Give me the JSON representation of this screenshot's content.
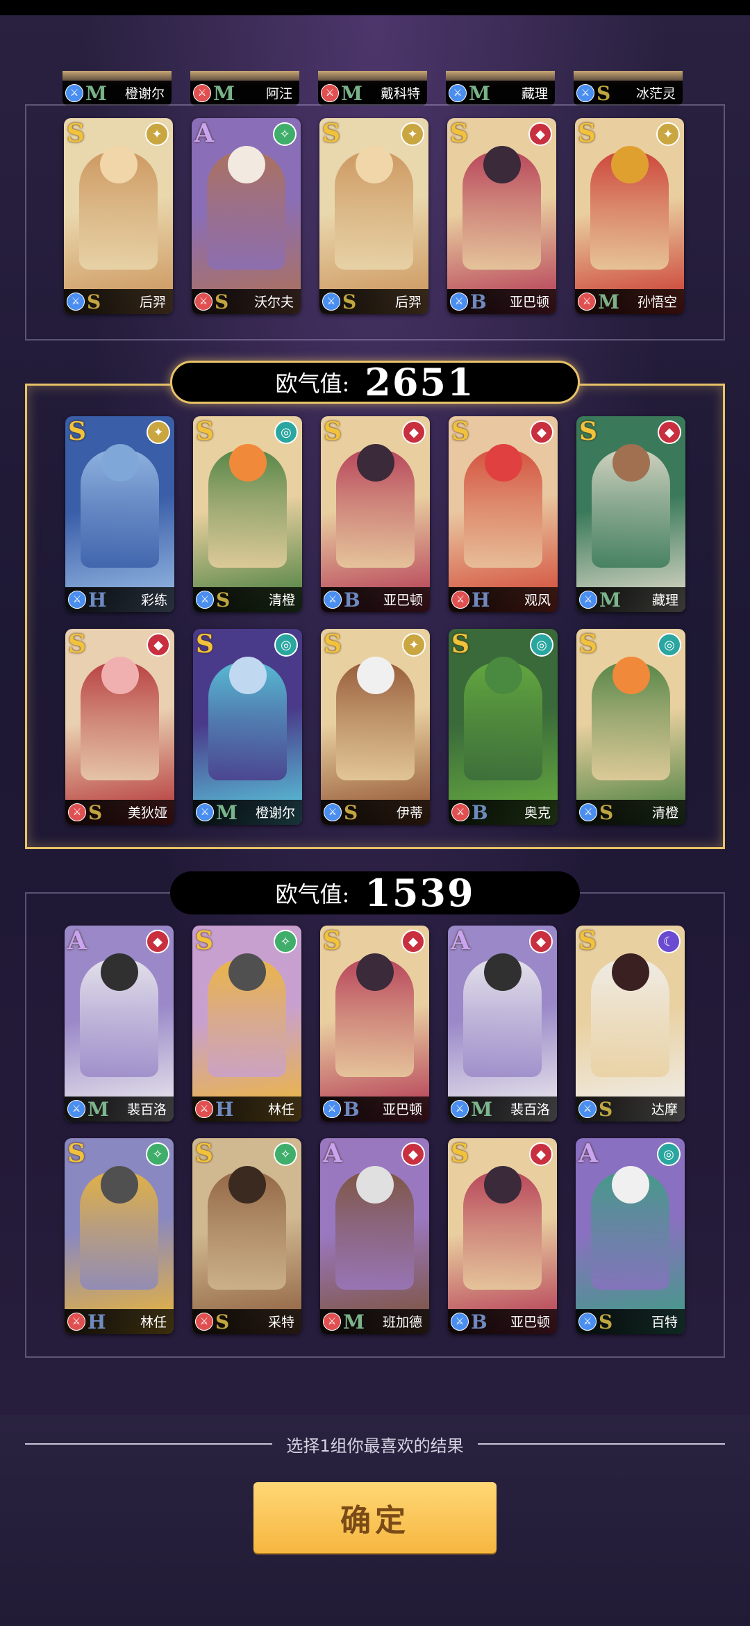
{
  "colors": {
    "gold": "#e8c267",
    "rank_S": "#f2c23a",
    "rank_A": "#c9a4f0",
    "tier_S": "#e0c14a",
    "tier_M": "#8fd1a0",
    "tier_B": "#7fa0e0",
    "tier_H": "#7fa0e0"
  },
  "top_partial": [
    {
      "name": "橙谢尔",
      "class_icon": "sword-icon",
      "class_color": "#4a8ef0",
      "tier": "M",
      "tier_color": "#8fd1a0"
    },
    {
      "name": "阿汪",
      "class_icon": "shield-icon",
      "class_color": "#e05050",
      "tier": "M",
      "tier_color": "#8fd1a0"
    },
    {
      "name": "戴科特",
      "class_icon": "sword-icon",
      "class_color": "#e05050",
      "tier": "M",
      "tier_color": "#8fd1a0"
    },
    {
      "name": "藏理",
      "class_icon": "heart-icon",
      "class_color": "#4a8ef0",
      "tier": "M",
      "tier_color": "#8fd1a0"
    },
    {
      "name": "冰茫灵",
      "class_icon": "sword-icon",
      "class_color": "#4a8ef0",
      "tier": "S",
      "tier_color": "#e0c14a"
    }
  ],
  "group0": {
    "cards": [
      {
        "rank": "S",
        "element": "light",
        "elem_color": "#c9a640",
        "elem_icon": "✦",
        "art": "#e9d7ad",
        "art2": "#c98f55",
        "head": "#f0d6a8",
        "class_color": "#4a8ef0",
        "tier": "S",
        "tier_color": "#e0c14a",
        "name": "后羿"
      },
      {
        "rank": "A",
        "element": "wind",
        "elem_color": "#3fae6a",
        "elem_icon": "✧",
        "art": "#8a6fb8",
        "art2": "#b07050",
        "head": "#f2e9e0",
        "class_color": "#e05050",
        "tier": "S",
        "tier_color": "#e0c14a",
        "name": "沃尔夫"
      },
      {
        "rank": "S",
        "element": "light",
        "elem_color": "#c9a640",
        "elem_icon": "✦",
        "art": "#e9d7ad",
        "art2": "#c98f55",
        "head": "#f0d6a8",
        "class_color": "#4a8ef0",
        "tier": "S",
        "tier_color": "#e0c14a",
        "name": "后羿"
      },
      {
        "rank": "S",
        "element": "fire",
        "elem_color": "#c83040",
        "elem_icon": "◆",
        "art": "#e9cfa0",
        "art2": "#b03050",
        "head": "#3a2a3a",
        "class_color": "#4a8ef0",
        "tier": "B",
        "tier_color": "#7fa0e0",
        "name": "亚巴顿"
      },
      {
        "rank": "S",
        "element": "light",
        "elem_color": "#c9a640",
        "elem_icon": "✦",
        "art": "#e9cfa0",
        "art2": "#c8302a",
        "head": "#e0a030",
        "class_color": "#e05050",
        "tier": "M",
        "tier_color": "#8fd1a0",
        "name": "孙悟空"
      }
    ]
  },
  "group1": {
    "score_label": "欧气值:",
    "score_value": "2651",
    "cards": [
      {
        "rank": "S",
        "element": "light",
        "elem_color": "#c9a640",
        "elem_icon": "✦",
        "art": "#3a5ea8",
        "art2": "#9ec0e8",
        "head": "#7fa8d8",
        "class_color": "#4a8ef0",
        "tier": "H",
        "tier_color": "#7fa0e0",
        "name": "彩练"
      },
      {
        "rank": "S",
        "element": "water",
        "elem_color": "#2aa6a0",
        "elem_icon": "◎",
        "art": "#e9d0a0",
        "art2": "#3f7a3a",
        "head": "#f08a3a",
        "class_color": "#4a8ef0",
        "tier": "S",
        "tier_color": "#e0c14a",
        "name": "清橙"
      },
      {
        "rank": "S",
        "element": "fire",
        "elem_color": "#c83040",
        "elem_icon": "◆",
        "art": "#e9cfa0",
        "art2": "#b03050",
        "head": "#3a2a3a",
        "class_color": "#4a8ef0",
        "tier": "B",
        "tier_color": "#7fa0e0",
        "name": "亚巴顿"
      },
      {
        "rank": "S",
        "element": "fire",
        "elem_color": "#c83040",
        "elem_icon": "◆",
        "art": "#e9c7a0",
        "art2": "#d04030",
        "head": "#e04040",
        "class_color": "#e05050",
        "tier": "H",
        "tier_color": "#7fa0e0",
        "name": "观风"
      },
      {
        "rank": "S",
        "element": "fire",
        "elem_color": "#c83040",
        "elem_icon": "◆",
        "art": "#3a7a5a",
        "art2": "#e9e0d0",
        "head": "#a07050",
        "class_color": "#4a8ef0",
        "tier": "M",
        "tier_color": "#8fd1a0",
        "name": "藏理"
      },
      {
        "rank": "S",
        "element": "fire",
        "elem_color": "#c83040",
        "elem_icon": "◆",
        "art": "#e9d0b0",
        "art2": "#b02a30",
        "head": "#f0b0b0",
        "class_color": "#e05050",
        "tier": "S",
        "tier_color": "#e0c14a",
        "name": "美狄娅"
      },
      {
        "rank": "S",
        "element": "water",
        "elem_color": "#2aa6a0",
        "elem_icon": "◎",
        "art": "#4a3a8a",
        "art2": "#5ad0e0",
        "head": "#c0d8f0",
        "class_color": "#4a8ef0",
        "tier": "M",
        "tier_color": "#8fd1a0",
        "name": "橙谢尔"
      },
      {
        "rank": "S",
        "element": "light",
        "elem_color": "#c9a640",
        "elem_icon": "✦",
        "art": "#e9d0a0",
        "art2": "#8a4a2a",
        "head": "#f0f0f0",
        "class_color": "#4a8ef0",
        "tier": "S",
        "tier_color": "#e0c14a",
        "name": "伊蒂"
      },
      {
        "rank": "S",
        "element": "water",
        "elem_color": "#2aa6a0",
        "elem_icon": "◎",
        "art": "#3a6a3a",
        "art2": "#6ab040",
        "head": "#4a8a40",
        "class_color": "#e05050",
        "tier": "B",
        "tier_color": "#7fa0e0",
        "name": "奥克"
      },
      {
        "rank": "S",
        "element": "water",
        "elem_color": "#2aa6a0",
        "elem_icon": "◎",
        "art": "#e9d0a0",
        "art2": "#3f7a3a",
        "head": "#f08a3a",
        "class_color": "#4a8ef0",
        "tier": "S",
        "tier_color": "#e0c14a",
        "name": "清橙"
      }
    ]
  },
  "group2": {
    "score_label": "欧气值:",
    "score_value": "1539",
    "cards": [
      {
        "rank": "A",
        "element": "fire",
        "elem_color": "#c83040",
        "elem_icon": "◆",
        "art": "#9a88c8",
        "art2": "#f0f0f0",
        "head": "#303030",
        "class_color": "#4a8ef0",
        "tier": "M",
        "tier_color": "#8fd1a0",
        "name": "裴百洛"
      },
      {
        "rank": "S",
        "element": "wind",
        "elem_color": "#3fae6a",
        "elem_icon": "✧",
        "art": "#c8a0d0",
        "art2": "#f0b830",
        "head": "#505050",
        "class_color": "#e05050",
        "tier": "H",
        "tier_color": "#7fa0e0",
        "name": "林任"
      },
      {
        "rank": "S",
        "element": "fire",
        "elem_color": "#c83040",
        "elem_icon": "◆",
        "art": "#e9cfa0",
        "art2": "#b03050",
        "head": "#3a2a3a",
        "class_color": "#4a8ef0",
        "tier": "B",
        "tier_color": "#7fa0e0",
        "name": "亚巴顿"
      },
      {
        "rank": "A",
        "element": "fire",
        "elem_color": "#c83040",
        "elem_icon": "◆",
        "art": "#9a88c8",
        "art2": "#f0f0f0",
        "head": "#303030",
        "class_color": "#4a8ef0",
        "tier": "M",
        "tier_color": "#8fd1a0",
        "name": "裴百洛"
      },
      {
        "rank": "S",
        "element": "dark",
        "elem_color": "#6a4ad0",
        "elem_icon": "☾",
        "art": "#e9d0a0",
        "art2": "#f0f0f0",
        "head": "#3a2020",
        "class_color": "#4a8ef0",
        "tier": "S",
        "tier_color": "#e0c14a",
        "name": "达摩"
      },
      {
        "rank": "S",
        "element": "wind",
        "elem_color": "#3fae6a",
        "elem_icon": "✧",
        "art": "#8a88c0",
        "art2": "#f0b830",
        "head": "#505050",
        "class_color": "#e05050",
        "tier": "H",
        "tier_color": "#7fa0e0",
        "name": "林任"
      },
      {
        "rank": "S",
        "element": "wind",
        "elem_color": "#3fae6a",
        "elem_icon": "✧",
        "art": "#d0b890",
        "art2": "#8a5a3a",
        "head": "#3a2a20",
        "class_color": "#e05050",
        "tier": "S",
        "tier_color": "#e0c14a",
        "name": "采特"
      },
      {
        "rank": "A",
        "element": "fire",
        "elem_color": "#c83040",
        "elem_icon": "◆",
        "art": "#9a78c0",
        "art2": "#7a5030",
        "head": "#e0e0e0",
        "class_color": "#e05050",
        "tier": "M",
        "tier_color": "#8fd1a0",
        "name": "班加德"
      },
      {
        "rank": "S",
        "element": "fire",
        "elem_color": "#c83040",
        "elem_icon": "◆",
        "art": "#e9cfa0",
        "art2": "#b03050",
        "head": "#3a2a3a",
        "class_color": "#4a8ef0",
        "tier": "B",
        "tier_color": "#7fa0e0",
        "name": "亚巴顿"
      },
      {
        "rank": "A",
        "element": "water",
        "elem_color": "#2aa6a0",
        "elem_icon": "◎",
        "art": "#8a70c0",
        "art2": "#3aa080",
        "head": "#f0f0f0",
        "class_color": "#4a8ef0",
        "tier": "S",
        "tier_color": "#e0c14a",
        "name": "百特"
      }
    ]
  },
  "footer": {
    "hint": "选择1组你最喜欢的结果",
    "confirm_label": "确定"
  }
}
